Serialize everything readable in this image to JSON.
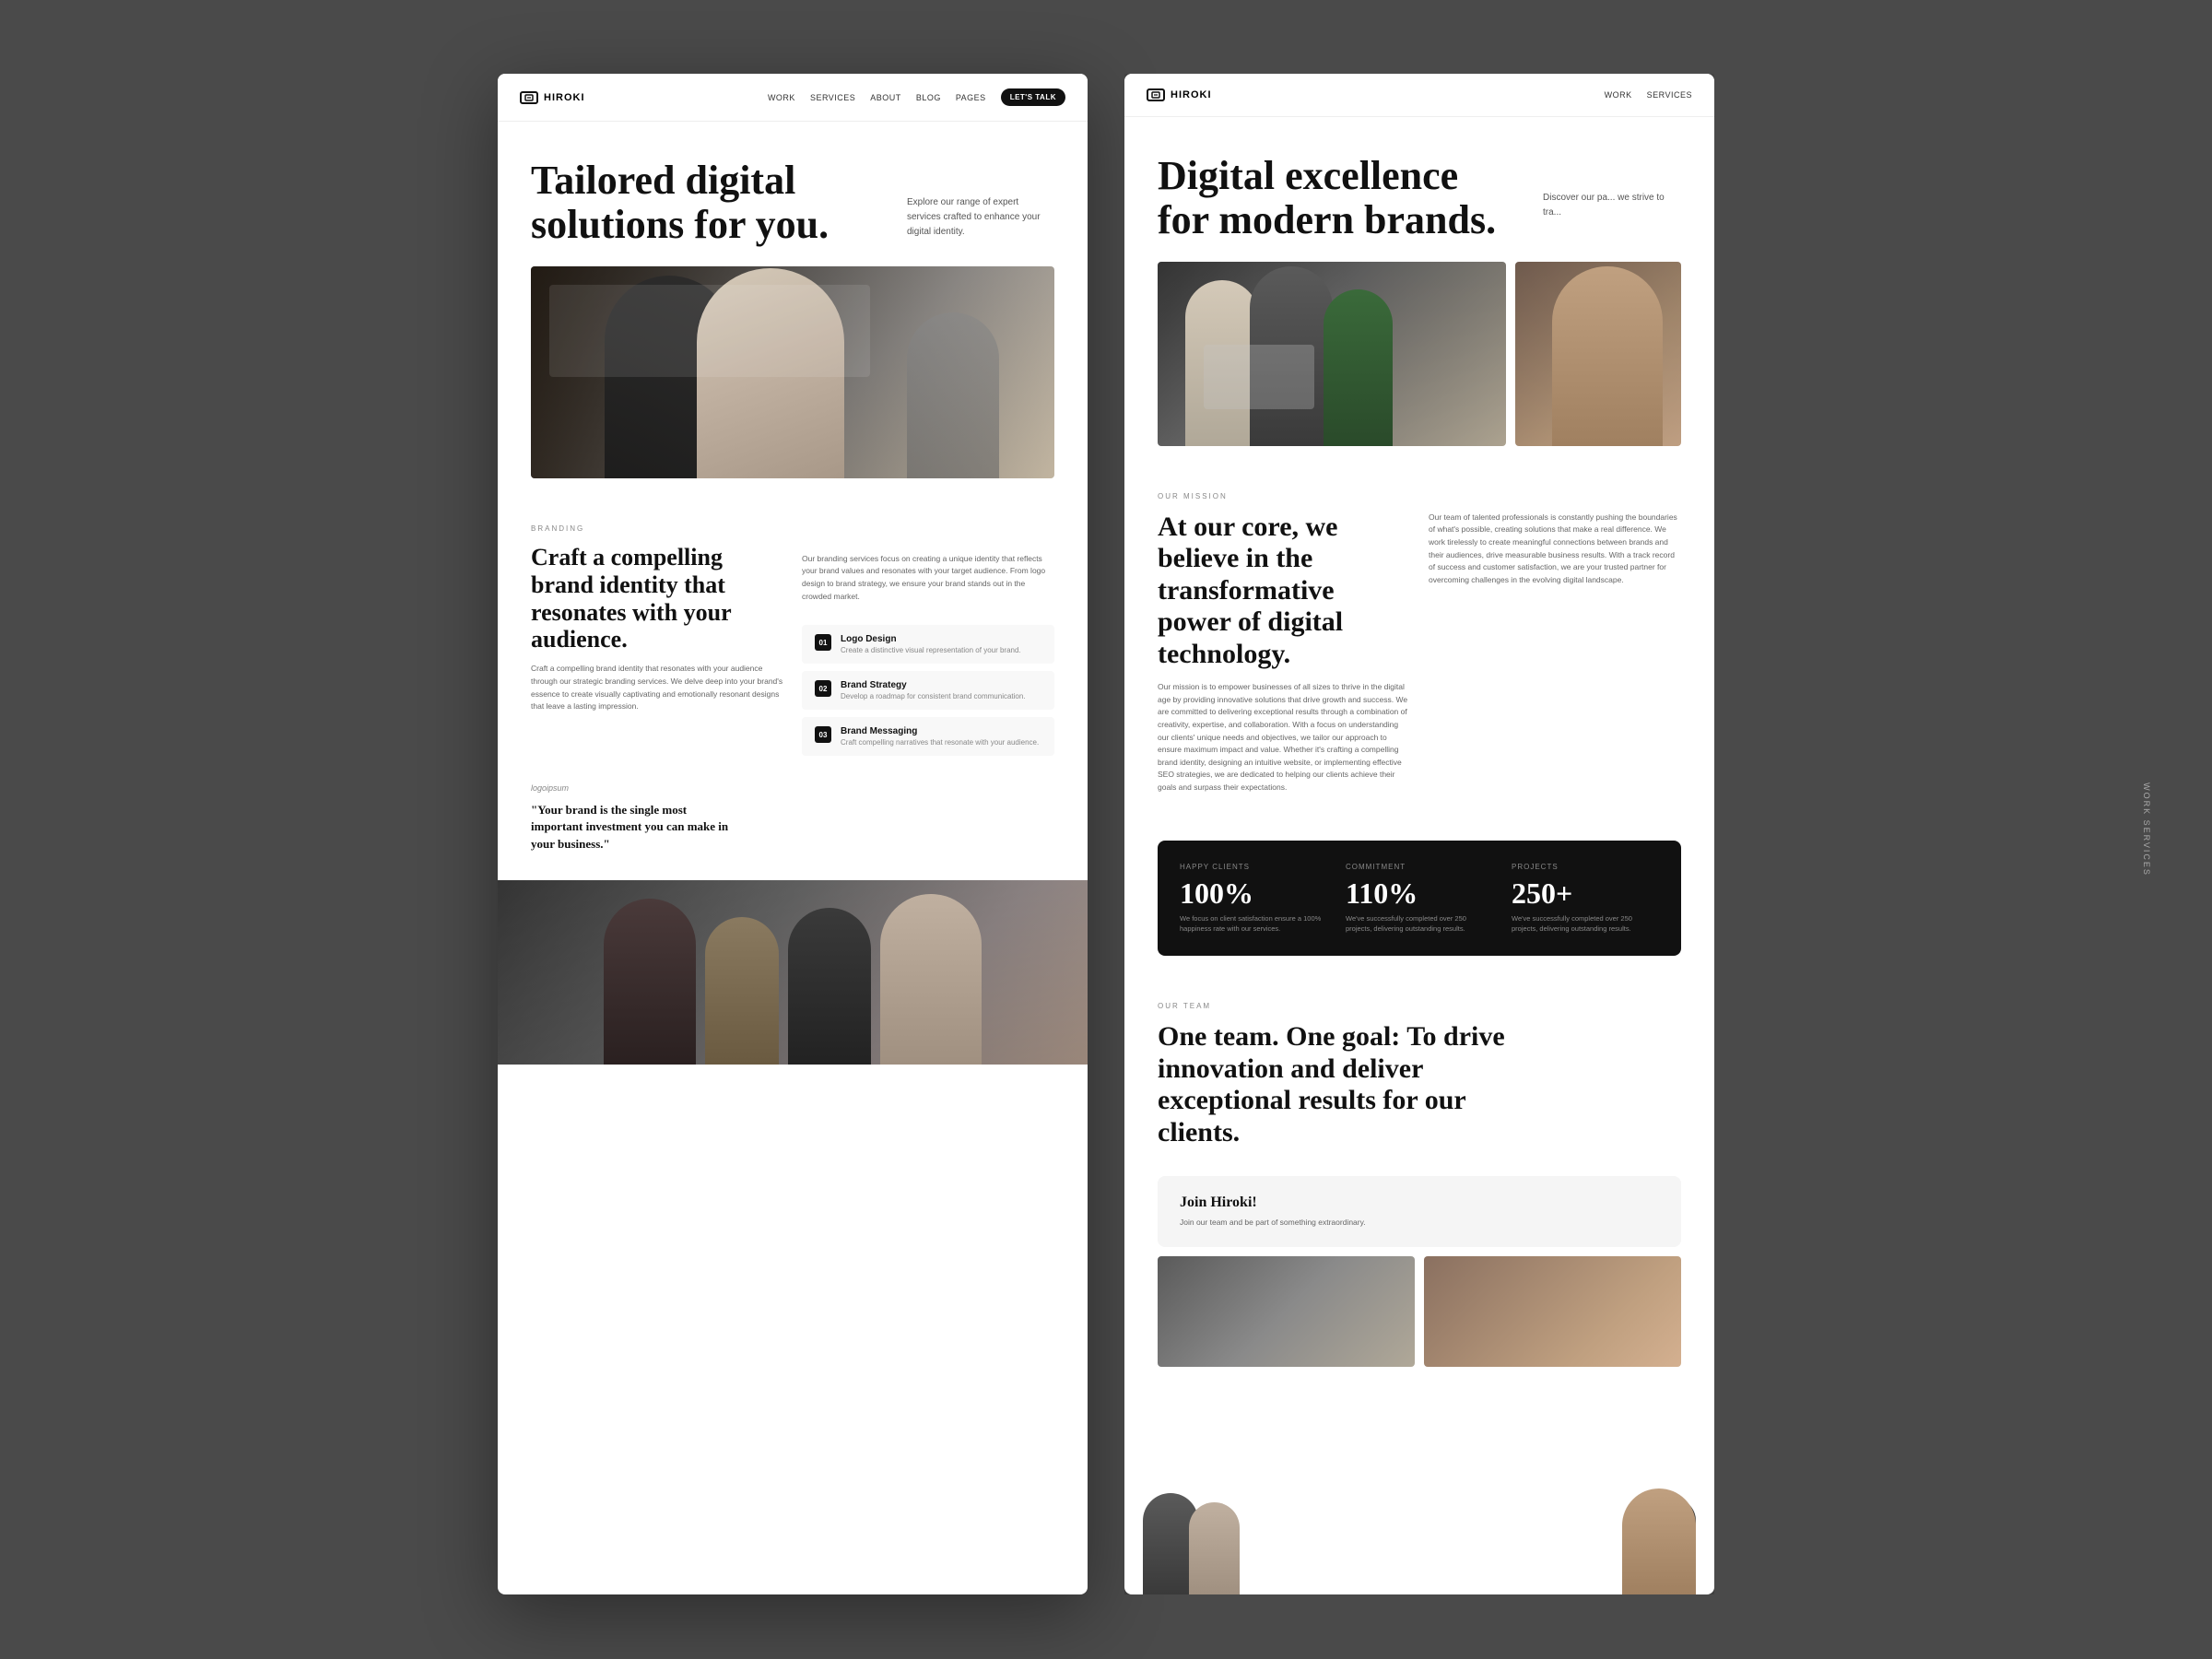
{
  "desktop": {
    "bg_color": "#4a4a4a"
  },
  "panel1": {
    "nav": {
      "logo": "HIROKI",
      "links": [
        "WORK",
        "SERVICES",
        "ABOUT",
        "BLOG",
        "PAGES"
      ],
      "cta": "LET'S TALK"
    },
    "hero": {
      "title": "Tailored digital solutions for you.",
      "description": "Explore our range of expert services crafted to enhance your digital identity."
    },
    "branding": {
      "tag": "BRANDING",
      "title": "Craft a compelling brand identity that resonates with your audience.",
      "desc1": "Craft a compelling brand identity that resonates with your audience through our strategic branding services. We delve deep into your brand's essence to create visually captivating and emotionally resonant designs that leave a lasting impression.",
      "desc2": "Our branding services focus on creating a unique identity that reflects your brand values and resonates with your target audience. From logo design to brand strategy, we ensure your brand stands out in the crowded market.",
      "services": [
        {
          "number": "01",
          "title": "Logo Design",
          "desc": "Create a distinctive visual representation of your brand."
        },
        {
          "number": "02",
          "title": "Brand Strategy",
          "desc": "Develop a roadmap for consistent brand communication."
        },
        {
          "number": "03",
          "title": "Brand Messaging",
          "desc": "Craft compelling narratives that resonate with your audience."
        }
      ]
    },
    "quote": {
      "logo": "logoipsum",
      "text": "\"Your brand is the single most important investment you can make in your business.\""
    }
  },
  "panel2": {
    "nav": {
      "logo": "HIROKI",
      "links": [
        "WORK",
        "SERVICES"
      ],
      "cta": ""
    },
    "hero": {
      "title": "Digital excellence for modern brands.",
      "description": "Discover our pa... we strive to tra..."
    },
    "mission": {
      "tag": "OUR MISSION",
      "title": "At our core, we believe in the transformative power of digital technology.",
      "desc1": "Our mission is to empower businesses of all sizes to thrive in the digital age by providing innovative solutions that drive growth and success. We are committed to delivering exceptional results through a combination of creativity, expertise, and collaboration. With a focus on understanding our clients' unique needs and objectives, we tailor our approach to ensure maximum impact and value. Whether it's crafting a compelling brand identity, designing an intuitive website, or implementing effective SEO strategies, we are dedicated to helping our clients achieve their goals and surpass their expectations.",
      "desc2": "Our team of talented professionals is constantly pushing the boundaries of what's possible, creating solutions that make a real difference. We work tirelessly to create meaningful connections between brands and their audiences, drive measurable business results. With a track record of success and customer satisfaction, we are your trusted partner for overcoming challenges in the evolving digital landscape."
    },
    "stats": [
      {
        "label": "HAPPY CLIENTS",
        "value": "100%",
        "desc": "We focus on client satisfaction ensure a 100% happiness rate with our services."
      },
      {
        "label": "COMMITMENT",
        "value": "110%",
        "desc": "We've successfully completed over 250 projects, delivering outstanding results."
      },
      {
        "label": "PROJECTS",
        "value": "250+",
        "desc": "We've successfully completed over 250 projects, delivering outstanding results."
      }
    ],
    "team": {
      "tag": "OUR TEAM",
      "title": "One team. One goal: To drive innovation and deliver exceptional results for our clients."
    },
    "join": {
      "title": "Join Hiroki!",
      "desc": "Join our team and be part of something extraordinary."
    }
  },
  "sidebar": {
    "text": "WoRK SERVICES"
  }
}
